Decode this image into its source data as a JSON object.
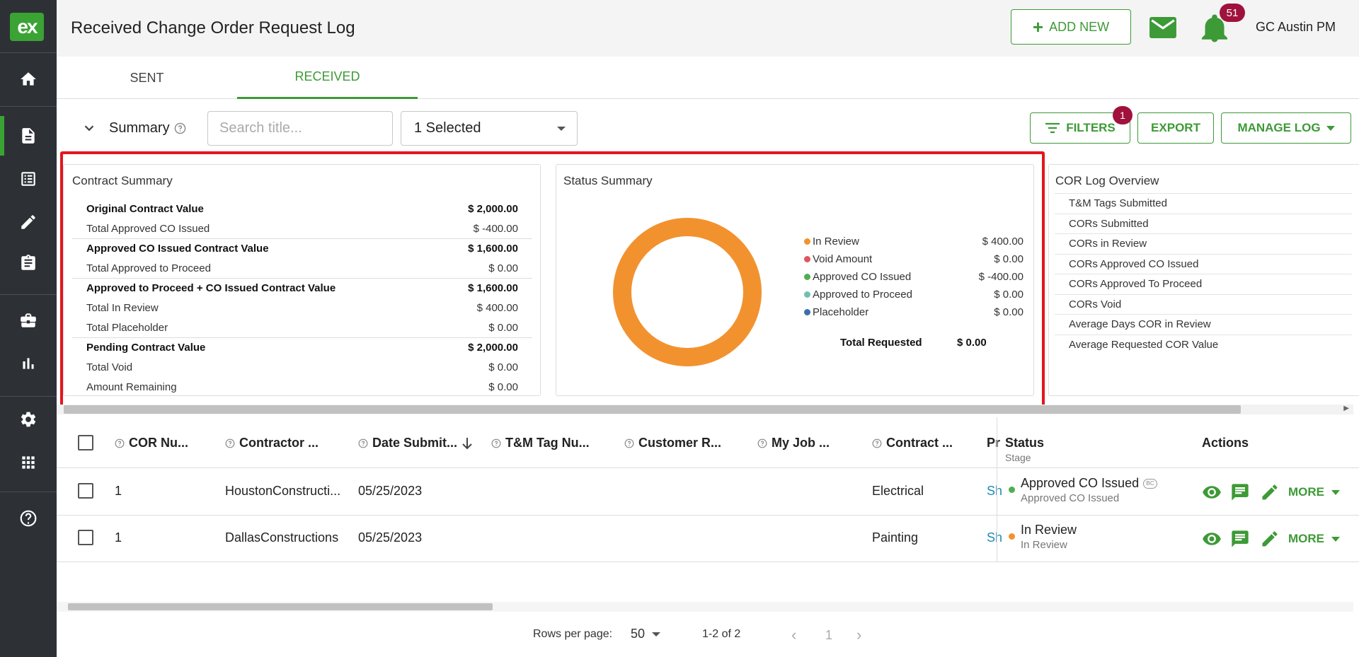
{
  "sidebar": {
    "logo": "ex",
    "items": [
      {
        "name": "home-icon"
      },
      {
        "name": "document-icon",
        "active": true
      },
      {
        "name": "list-icon"
      },
      {
        "name": "pencil-icon"
      },
      {
        "name": "clipboard-icon"
      },
      {
        "name": "briefcase-icon"
      },
      {
        "name": "bar-chart-icon"
      },
      {
        "name": "gear-icon"
      },
      {
        "name": "apps-grid-icon"
      },
      {
        "name": "help-icon"
      }
    ]
  },
  "header": {
    "title": "Received Change Order Request Log",
    "add_new_label": "ADD NEW",
    "notification_count": "51",
    "user_name": "GC Austin PM"
  },
  "tabs": [
    {
      "label": "SENT"
    },
    {
      "label": "RECEIVED",
      "active": true
    }
  ],
  "toolbar": {
    "summary_label": "Summary",
    "search_placeholder": "Search title...",
    "select_value": "1 Selected",
    "filters_label": "FILTERS",
    "filters_count": "1",
    "export_label": "EXPORT",
    "manage_log_label": "MANAGE LOG"
  },
  "contract_summary": {
    "title": "Contract Summary",
    "rows": [
      {
        "label": "Original Contract Value",
        "value": "$ 2,000.00",
        "bold": true
      },
      {
        "label": "Total Approved CO Issued",
        "value": "$ -400.00"
      },
      {
        "label": "Approved CO Issued Contract Value",
        "value": "$ 1,600.00",
        "bold": true
      },
      {
        "label": "Total Approved to Proceed",
        "value": "$ 0.00"
      },
      {
        "label": "Approved to Proceed + CO Issued Contract Value",
        "value": "$ 1,600.00",
        "bold": true
      },
      {
        "label": "Total In Review",
        "value": "$ 400.00"
      },
      {
        "label": "Total Placeholder",
        "value": "$ 0.00"
      },
      {
        "label": "Pending Contract Value",
        "value": "$ 2,000.00",
        "bold": true
      },
      {
        "label": "Total Void",
        "value": "$ 0.00"
      },
      {
        "label": "Amount Remaining",
        "value": "$ 0.00"
      }
    ]
  },
  "status_summary": {
    "title": "Status Summary",
    "legend": [
      {
        "label": "In Review",
        "value": "$ 400.00",
        "color": "#f2922f"
      },
      {
        "label": "Void Amount",
        "value": "$ 0.00",
        "color": "#e0555e"
      },
      {
        "label": "Approved CO Issued",
        "value": "$ -400.00",
        "color": "#4caf50"
      },
      {
        "label": "Approved to Proceed",
        "value": "$ 0.00",
        "color": "#6fc0b4"
      },
      {
        "label": "Placeholder",
        "value": "$ 0.00",
        "color": "#3d6fa8"
      }
    ],
    "total_label": "Total Requested",
    "total_value": "$ 0.00",
    "donut_color": "#f2922f"
  },
  "cor_overview": {
    "title": "COR Log Overview",
    "rows": [
      "T&M Tags Submitted",
      "CORs Submitted",
      "CORs in Review",
      "CORs Approved CO Issued",
      "CORs Approved To Proceed",
      "CORs Void",
      "Average Days COR in Review",
      "Average Requested COR Value"
    ]
  },
  "table": {
    "columns": [
      {
        "label": "COR Nu..."
      },
      {
        "label": "Contractor ..."
      },
      {
        "label": "Date Submit..."
      },
      {
        "label": "T&M Tag Nu..."
      },
      {
        "label": "Customer R..."
      },
      {
        "label": "My Job ..."
      },
      {
        "label": "Contract ..."
      },
      {
        "label": "Pr"
      }
    ],
    "status_header": "Status",
    "status_subheader": "Stage",
    "actions_header": "Actions",
    "more_label": "MORE",
    "rows": [
      {
        "cor": "1",
        "contractor": "HoustonConstructi...",
        "date": "05/25/2023",
        "contract": "Electrical",
        "pr": "Sh",
        "status": "Approved CO Issued",
        "stage": "Approved CO Issued",
        "status_color": "#4caf50",
        "badge": "BC"
      },
      {
        "cor": "1",
        "contractor": "DallasConstructions",
        "date": "05/25/2023",
        "contract": "Painting",
        "pr": "Sh",
        "status": "In Review",
        "stage": "In Review",
        "status_color": "#f2922f"
      }
    ]
  },
  "pagination": {
    "rows_per_page_label": "Rows per page:",
    "rows_per_page": "50",
    "range": "1-2 of 2",
    "page": "1"
  },
  "colors": {
    "accent": "#3d9a36",
    "sidebar": "#2d3136",
    "badge": "#a0123c",
    "highlight": "#e2171c"
  }
}
